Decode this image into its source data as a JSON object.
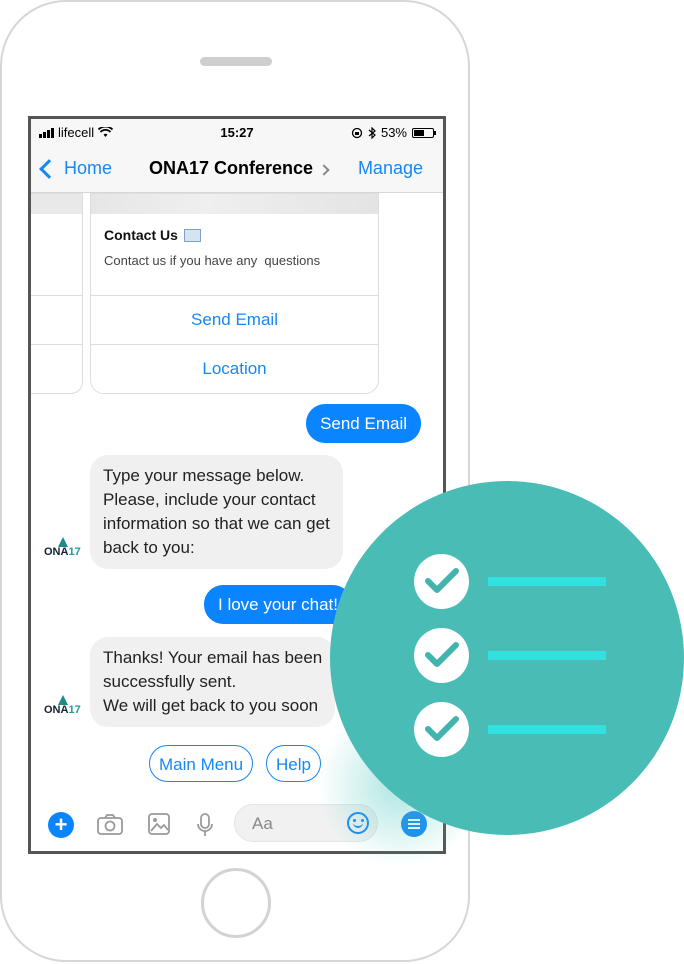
{
  "status_bar": {
    "carrier": "lifecell",
    "time": "15:27",
    "battery": "53%"
  },
  "nav": {
    "back_label": "Home",
    "title": "ONA17 Conference",
    "action_label": "Manage"
  },
  "card": {
    "title": "Contact Us",
    "subtitle": "Contact us if you have any  questions",
    "buttons": [
      "Send Email",
      "Location"
    ]
  },
  "messages": [
    {
      "from": "user",
      "text": "Send Email"
    },
    {
      "from": "bot",
      "text": "Type your message below.\nPlease, include your contact\ninformation so that we can get\nback to you:"
    },
    {
      "from": "user",
      "text": "I love your chat!"
    },
    {
      "from": "bot",
      "text": "Thanks! Your email has been\nsuccessfully sent.\nWe will get back to you soon"
    }
  ],
  "avatar": {
    "text_main": "ONA",
    "text_accent": "17"
  },
  "quick_replies": [
    "Main Menu",
    "Help"
  ],
  "composer": {
    "placeholder": "Aa"
  },
  "colors": {
    "accent": "#1787f4",
    "bubble_out": "#0a84ff",
    "badge": "#49bcb6",
    "badge_lines": "#33e0e0"
  },
  "icons": [
    "wifi-icon",
    "bluetooth-icon",
    "lock-rotation-icon",
    "camera-icon",
    "image-icon",
    "microphone-icon",
    "emoji-icon",
    "menu-icon",
    "check-icon"
  ]
}
